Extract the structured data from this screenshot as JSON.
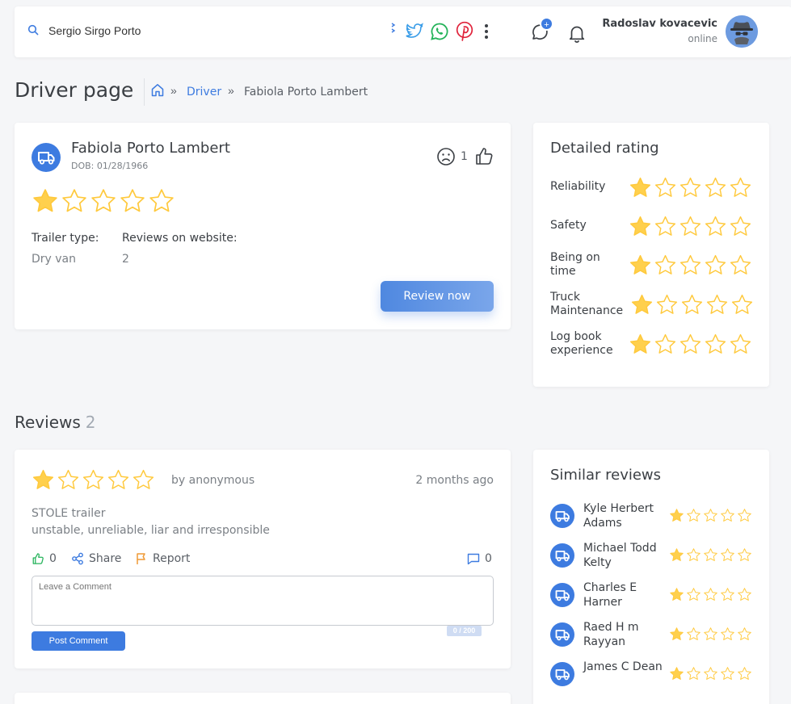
{
  "search": {
    "value": "Sergio Sirgo Porto",
    "placeholder": ""
  },
  "header": {
    "notification_badge": "+",
    "user_name": "Radoslav kovacevic",
    "user_status": "online"
  },
  "page": {
    "title": "Driver page",
    "breadcrumb_link": "Driver",
    "breadcrumb_current": "Fabiola Porto Lambert"
  },
  "driver": {
    "name": "Fabiola Porto Lambert",
    "dob": "DOB: 01/28/1966",
    "rating": 1,
    "dislikes": "1",
    "trailer_label": "Trailer type:",
    "trailer_value": "Dry van",
    "reviews_label": "Reviews on website:",
    "reviews_value": "2",
    "review_button": "Review now"
  },
  "detailed_rating": {
    "title": "Detailed rating",
    "items": [
      {
        "label": "Reliability",
        "rating": 1
      },
      {
        "label": "Safety",
        "rating": 1
      },
      {
        "label": "Being on time",
        "rating": 1
      },
      {
        "label": "Truck Maintenance",
        "rating": 1
      },
      {
        "label": "Log book experience",
        "rating": 1
      }
    ]
  },
  "reviews": {
    "title": "Reviews",
    "count": "2",
    "items": [
      {
        "rating": 1,
        "author": "by anonymous",
        "time": "2 months ago",
        "headline": "STOLE trailer",
        "body": "unstable, unreliable, liar and irresponsible",
        "likes": "0",
        "share": "Share",
        "report": "Report",
        "comments": "0",
        "comment_placeholder": "Leave a Comment",
        "counter": "0 / 200",
        "post_button": "Post Comment"
      }
    ]
  },
  "similar": {
    "title": "Similar reviews",
    "items": [
      {
        "name": "Kyle Herbert Adams",
        "rating": 1
      },
      {
        "name": "Michael Todd Kelty",
        "rating": 1
      },
      {
        "name": "Charles E Harner",
        "rating": 1
      },
      {
        "name": "Raed H m Rayyan",
        "rating": 1
      },
      {
        "name": "James C Dean",
        "rating": 1
      }
    ]
  },
  "colors": {
    "accent": "#3d7be0",
    "star": "#ffd04d",
    "star_outline": "#ffc93c"
  }
}
